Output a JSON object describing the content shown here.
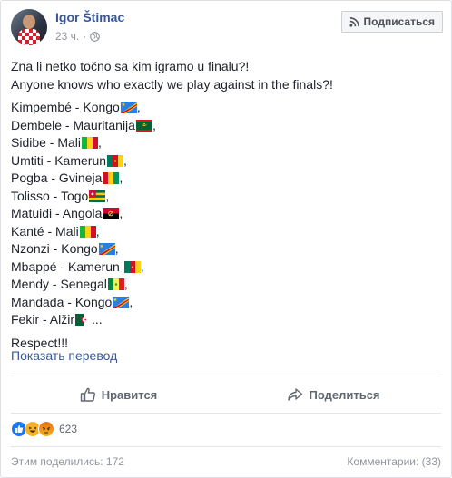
{
  "post": {
    "author": "Igor Štimac",
    "time": "23 ч.",
    "meta_separator": "·",
    "privacy_icon": "globe-icon",
    "subscribe_label": "Подписаться",
    "subscribe_icon": "rss-icon",
    "intro_line1": "Zna li netko točno sa kim igramo u finalu?!",
    "intro_line2": "Anyone knows who exactly we play against in the finals?!",
    "players": [
      {
        "text": "Kimpembé - Kongo",
        "flag": "cd",
        "suffix": ","
      },
      {
        "text": "Dembele - Mauritanija",
        "flag": "mr",
        "suffix": ","
      },
      {
        "text": "Sidibe - Mali",
        "flag": "ml",
        "suffix": ","
      },
      {
        "text": "Umtiti - Kamerun",
        "flag": "cm",
        "suffix": ","
      },
      {
        "text": "Pogba - Gvineja",
        "flag": "gn",
        "suffix": ","
      },
      {
        "text": "Tolisso - Togo",
        "flag": "tg",
        "suffix": ","
      },
      {
        "text": "Matuidi - Angola",
        "flag": "ao",
        "suffix": ","
      },
      {
        "text": "Kanté - Mali",
        "flag": "ml",
        "suffix": ","
      },
      {
        "text": "Nzonzi - Kongo",
        "flag": "cd",
        "suffix": ","
      },
      {
        "text": "Mbappé - Kamerun ",
        "flag": "cm",
        "suffix": ","
      },
      {
        "text": "Mendy - Senegal",
        "flag": "sn",
        "suffix": ","
      },
      {
        "text": "Mandada - Kongo",
        "flag": "cd",
        "suffix": ","
      },
      {
        "text": "Fekir - Alžir",
        "flag": "dz",
        "suffix": "..."
      }
    ],
    "closing": "Respect!!!",
    "translate_link": "Показать перевод"
  },
  "actions": {
    "like_label": "Нравится",
    "share_label": "Поделиться"
  },
  "reactions": {
    "icons": [
      "like-reaction-icon",
      "haha-reaction-icon",
      "angry-reaction-icon"
    ],
    "count": "623"
  },
  "footer": {
    "shares": "Этим поделились: 172",
    "comments": "Комментарии: (33)"
  },
  "colors": {
    "link": "#365899",
    "text": "#1d2129",
    "muted": "#90949c",
    "like_blue": "#1877f2",
    "reaction_yellow": "#f7b125",
    "angry_orange": "#e9710f"
  }
}
